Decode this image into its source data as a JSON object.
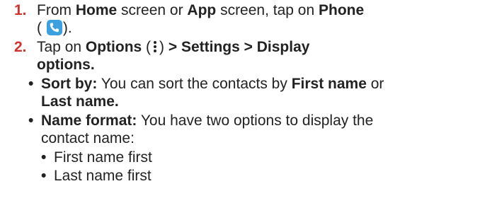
{
  "steps": [
    {
      "number": "1.",
      "line1": {
        "t1": "From ",
        "b1": "Home",
        "t2": " screen or ",
        "b2": "App",
        "t3": " screen, tap on ",
        "b3": "Phone"
      },
      "line2": {
        "open": "(",
        "close": ")."
      },
      "icon": "phone-icon"
    },
    {
      "number": "2.",
      "line1": {
        "t1": "Tap on ",
        "b1": "Options",
        "t2": " (",
        "t3": ") ",
        "b2": "> Settings > Display"
      },
      "line2": {
        "b1": "options."
      },
      "icon": "more-options-icon"
    }
  ],
  "sub_bullets": [
    {
      "label": "Sort by:",
      "text1": " You can sort the contacts by ",
      "bold1": "First name",
      "text2": " or",
      "line2_bold": "Last name."
    },
    {
      "label": "Name format:",
      "text1": " You have two options to display the",
      "line2": "contact name:",
      "options": [
        "First name first",
        "Last name first"
      ]
    }
  ],
  "bullet_char": "•",
  "colors": {
    "step_number": "#d0322e",
    "phone_icon_bg": "#3aa0e0",
    "text": "#222222"
  }
}
